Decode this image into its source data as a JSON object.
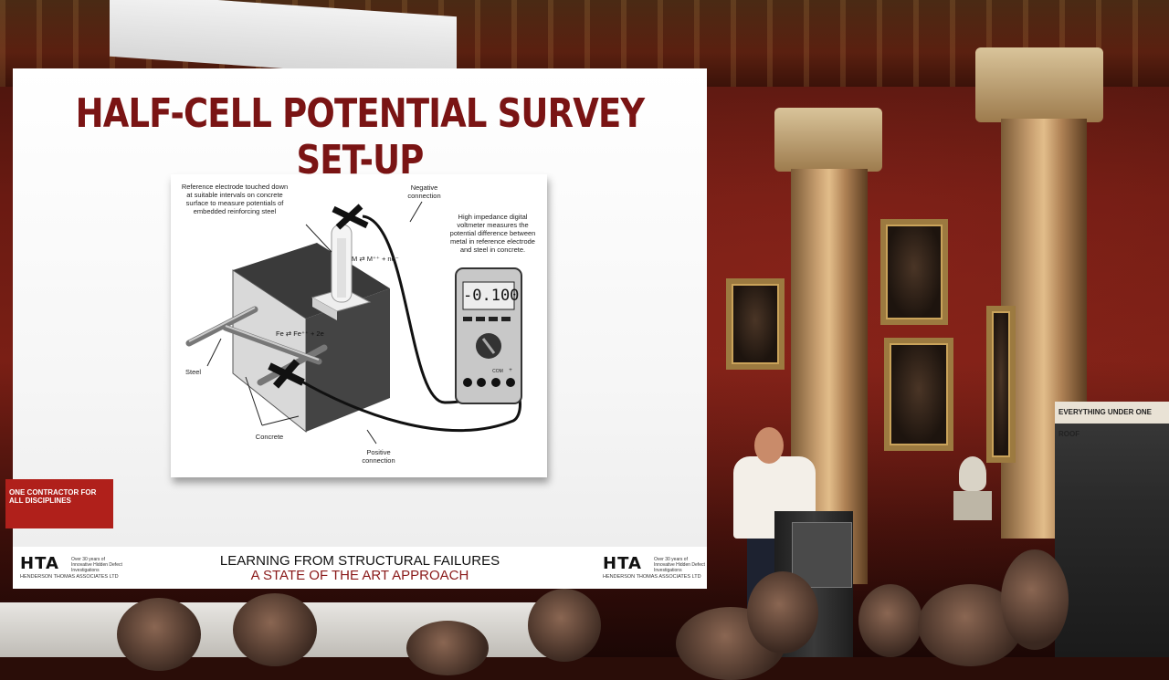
{
  "slide": {
    "title": "HALF-CELL POTENTIAL SURVEY SET-UP",
    "diagram": {
      "label_reference_electrode": "Reference electrode touched down at suitable intervals on concrete surface to measure potentials of embedded reinforcing steel",
      "label_negative": "Negative connection",
      "label_voltmeter": "High impedance digital voltmeter measures the potential difference between metal in reference electrode and steel in concrete.",
      "label_reaction_m": "M ⇄ M⁺⁺ + ne⁻",
      "label_reaction_fe": "Fe ⇄ Fe⁺⁺ + 2e",
      "label_steel": "Steel",
      "label_concrete": "Concrete",
      "label_positive": "Positive connection",
      "meter_reading": "-0.100",
      "meter_com": "COM",
      "meter_plus": "+"
    },
    "footer": {
      "logo_mark": "HTA",
      "logo_tagline": "Over 30 years of Innovative Hidden Defect Investigations",
      "logo_company": "HENDERSON THOMAS ASSOCIATES LTD",
      "event_title": "LEARNING FROM STRUCTURAL FAILURES",
      "event_subtitle": "A STATE OF THE ART APPROACH"
    }
  },
  "room": {
    "banner_heading": "EVERYTHING UNDER ONE ROOF",
    "banner_slogan": "ONE CONTRACTOR FOR ALL DISCIPLINES"
  },
  "colors": {
    "title_red": "#7a1414",
    "subtitle_red": "#8a1a1a",
    "wall_red": "#7a1f15"
  }
}
